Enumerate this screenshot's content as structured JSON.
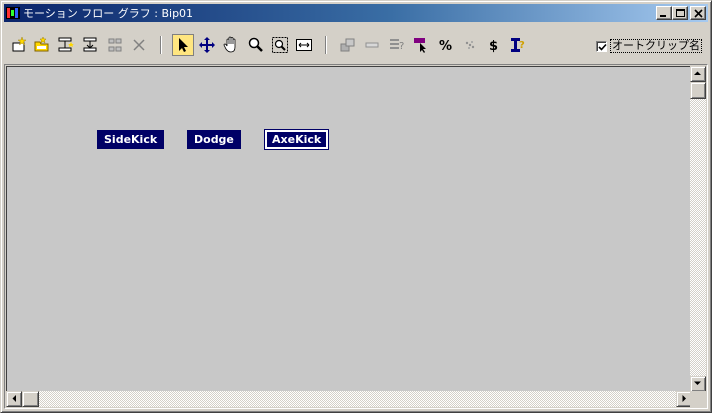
{
  "window": {
    "title": "モーション フロー グラフ : Bip01"
  },
  "toolbar": {
    "tools": [
      "create-clip-icon",
      "load-files-icon",
      "create-transition-icon",
      "create-transition-from-to-icon",
      "delete-transition-icon",
      "delete-icon",
      "select-icon",
      "move-icon",
      "pan-icon",
      "zoom-icon",
      "zoom-region-icon",
      "zoom-extents-icon",
      "show-scripts-icon",
      "clear-icon",
      "script-info-icon",
      "select-random-icon",
      "percent-icon",
      "random-options-icon",
      "dollar-icon",
      "clip-info-icon"
    ],
    "active_tool": "select-icon"
  },
  "autoclip": {
    "label": "オートクリップ名",
    "checked": true
  },
  "clips": [
    {
      "label": "SideKick",
      "selected": false
    },
    {
      "label": "Dodge",
      "selected": false
    },
    {
      "label": "AxeKick",
      "selected": true
    }
  ],
  "colors": {
    "clip_bg": "#000066",
    "canvas_bg": "#c8c8c8",
    "title_start": "#0a246a",
    "title_end": "#a6caf0",
    "active_tool_bg": "#ffe680"
  }
}
